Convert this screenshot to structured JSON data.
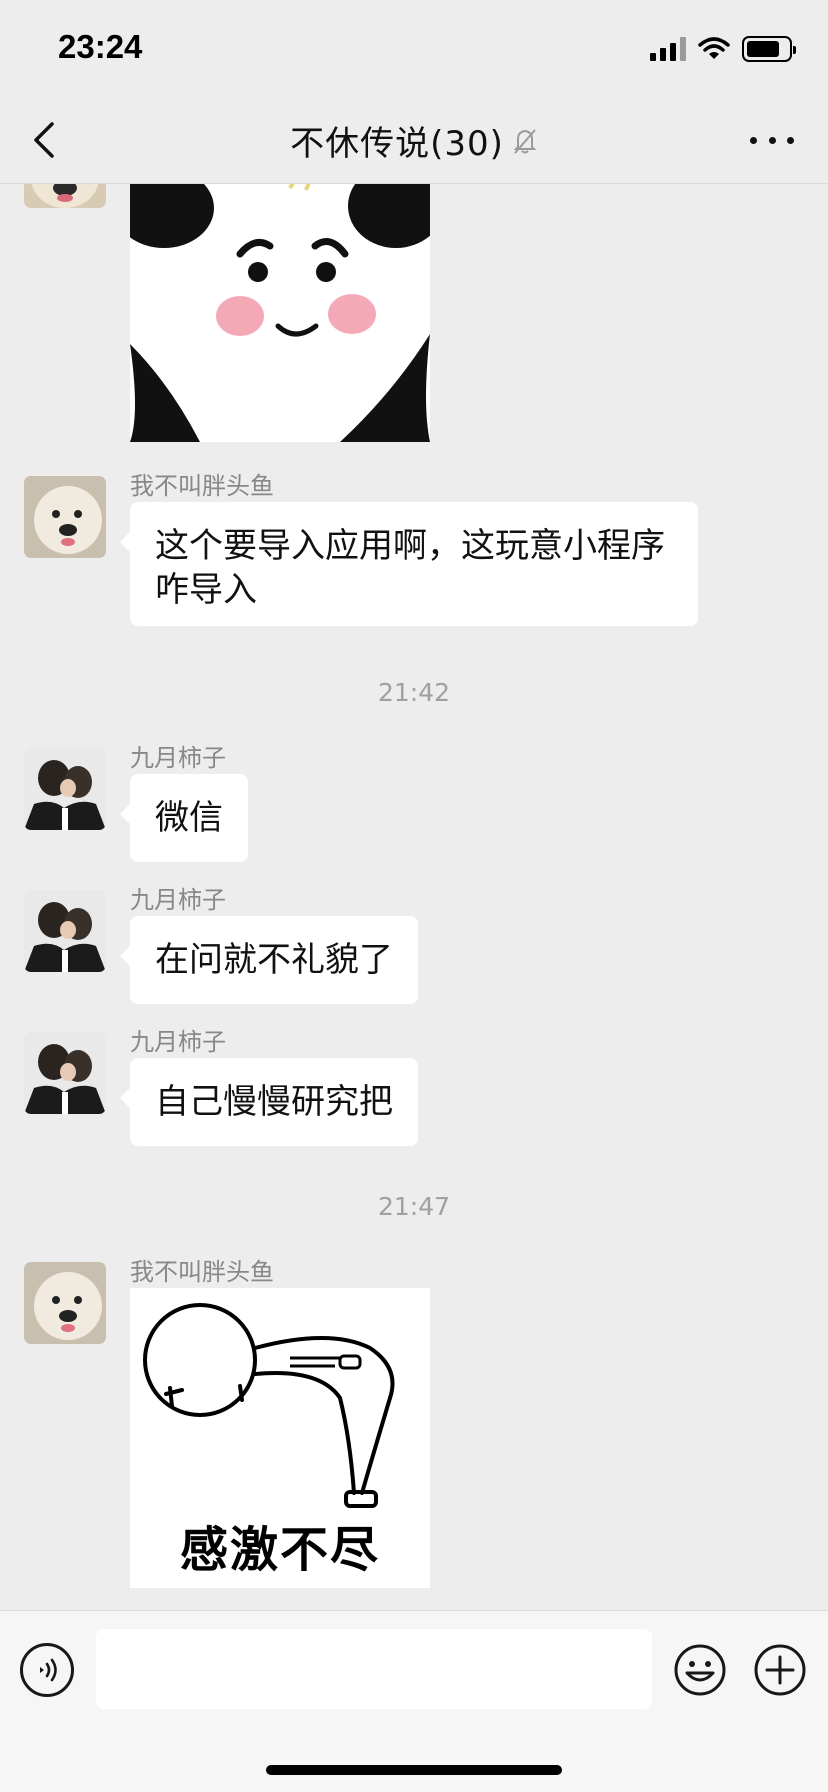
{
  "status_bar": {
    "time": "23:24"
  },
  "header": {
    "title": "不休传说(30)",
    "icons": {
      "back": "chevron-left-icon",
      "mute": "bell-muted-icon",
      "more": "more-dots-icon"
    }
  },
  "messages": [
    {
      "type": "sticker",
      "sticker": "panda-face-sticker",
      "avatar": "dog-avatar"
    },
    {
      "type": "text",
      "sender": "我不叫胖头鱼",
      "avatar": "dog-avatar",
      "lines": [
        "这个要导入应用啊，这玩意小程序",
        "咋导入"
      ]
    },
    {
      "type": "time",
      "text": "21:42"
    },
    {
      "type": "text",
      "sender": "九月柿子",
      "avatar": "couple-photo-avatar",
      "text": "微信"
    },
    {
      "type": "text",
      "sender": "九月柿子",
      "avatar": "couple-photo-avatar",
      "text": "在问就不礼貌了"
    },
    {
      "type": "text",
      "sender": "九月柿子",
      "avatar": "couple-photo-avatar",
      "text": "自己慢慢研究把"
    },
    {
      "type": "time",
      "text": "21:47"
    },
    {
      "type": "sticker",
      "sender": "我不叫胖头鱼",
      "avatar": "dog-avatar",
      "sticker": "bowing-stick-figure-sticker",
      "caption": "感激不尽"
    }
  ],
  "input_bar": {
    "placeholder": "",
    "icons": {
      "voice": "voice-icon",
      "emoji": "emoji-icon",
      "plus": "plus-icon"
    }
  },
  "colors": {
    "background": "#ededed",
    "bubble": "#ffffff",
    "name_text": "#888888",
    "timestamp": "#a0a0a0"
  }
}
